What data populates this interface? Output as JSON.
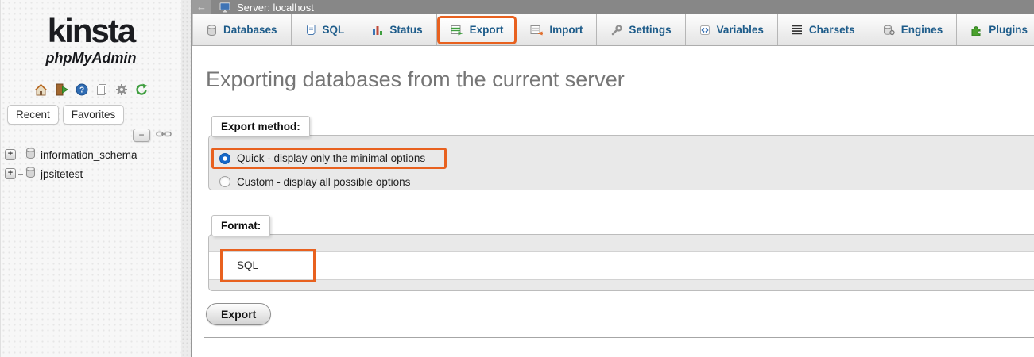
{
  "colors": {
    "accent_orange": "#e8611f",
    "tab_text_blue": "#1e5c8a",
    "heading_gray": "#767676",
    "topbar_gray": "#878787",
    "fieldset_gray": "#e9e9e9",
    "radio_selected_blue": "#1668c9"
  },
  "sidebar": {
    "logo_text": "kinsta",
    "logo_subtext": "phpMyAdmin",
    "recent_label": "Recent",
    "favorites_label": "Favorites",
    "collapse_label": "−",
    "tree": [
      {
        "expander": "+",
        "label": "information_schema"
      },
      {
        "expander": "+",
        "label": "jpsitetest"
      }
    ]
  },
  "topbar": {
    "back_arrow": "←",
    "server_label": "Server: localhost"
  },
  "tabs": [
    {
      "label": "Databases",
      "icon": "databases-icon",
      "active": false
    },
    {
      "label": "SQL",
      "icon": "sql-icon",
      "active": false
    },
    {
      "label": "Status",
      "icon": "status-icon",
      "active": false
    },
    {
      "label": "Export",
      "icon": "export-icon",
      "active": true
    },
    {
      "label": "Import",
      "icon": "import-icon",
      "active": false
    },
    {
      "label": "Settings",
      "icon": "settings-icon",
      "active": false
    },
    {
      "label": "Variables",
      "icon": "variables-icon",
      "active": false
    },
    {
      "label": "Charsets",
      "icon": "charsets-icon",
      "active": false
    },
    {
      "label": "Engines",
      "icon": "engines-icon",
      "active": false
    },
    {
      "label": "Plugins",
      "icon": "plugins-icon",
      "active": false
    }
  ],
  "content": {
    "heading": "Exporting databases from the current server",
    "export_method": {
      "legend": "Export method:",
      "quick_label": "Quick - display only the minimal options",
      "quick_selected": true,
      "custom_label": "Custom - display all possible options",
      "custom_selected": false
    },
    "format": {
      "legend": "Format:",
      "selected_value": "SQL"
    },
    "export_button_label": "Export"
  }
}
